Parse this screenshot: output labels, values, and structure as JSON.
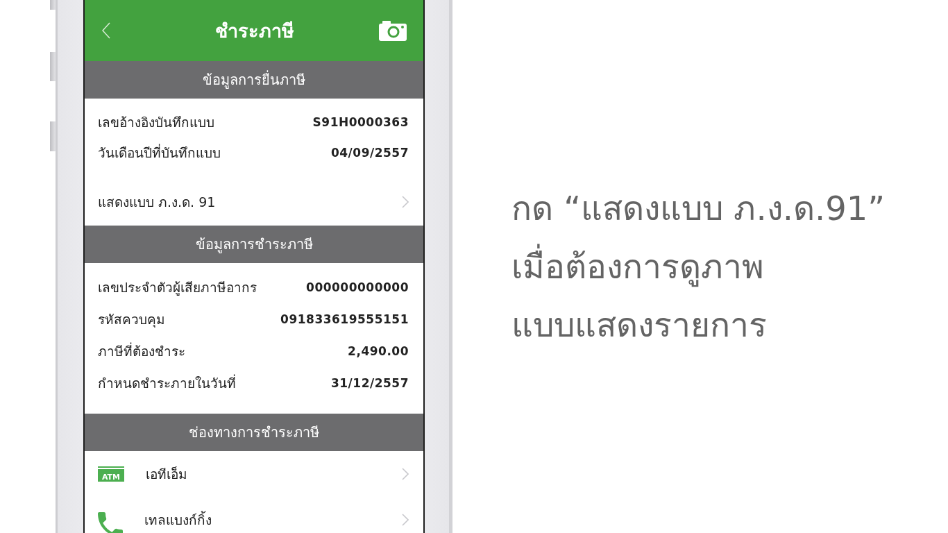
{
  "header": {
    "title": "ชำระภาษี"
  },
  "sections": [
    {
      "title": "ข้อมูลการยื่นภาษี",
      "rows": [
        {
          "kind": "field",
          "label": "เลขอ้างอิงบันทึกแบบ",
          "value": "S91H0000363"
        },
        {
          "kind": "field",
          "label": "วันเดือนปีที่บันทึกแบบ",
          "value": "04/09/2557"
        },
        {
          "kind": "link",
          "label": "แสดงแบบ ภ.ง.ด. 91"
        }
      ]
    },
    {
      "title": "ข้อมูลการชำระภาษี",
      "rows": [
        {
          "kind": "field",
          "label": "เลขประจำตัวผู้เสียภาษีอากร",
          "value": "000000000000"
        },
        {
          "kind": "field",
          "label": "รหัสควบคุม",
          "value": "091833619555151"
        },
        {
          "kind": "field",
          "label": "ภาษีที่ต้องชำระ",
          "value": "2,490.00"
        },
        {
          "kind": "field",
          "label": "กำหนดชำระภายในวันที่",
          "value": "31/12/2557"
        }
      ]
    },
    {
      "title": "ช่องทางการชำระภาษี",
      "rows": [
        {
          "kind": "channel",
          "icon": {
            "kind": "badge",
            "text": "ATM"
          },
          "label": "เอทีเอ็ม"
        },
        {
          "kind": "channel",
          "icon": {
            "kind": "phone"
          },
          "label": "เทลแบงก์กิ้ง"
        }
      ]
    }
  ],
  "caption": {
    "lines": [
      "กด “แสดงแบบ ภ.ง.ด.91”",
      "เมื่อต้องการดูภาพ",
      "แบบแสดงรายการ"
    ]
  }
}
